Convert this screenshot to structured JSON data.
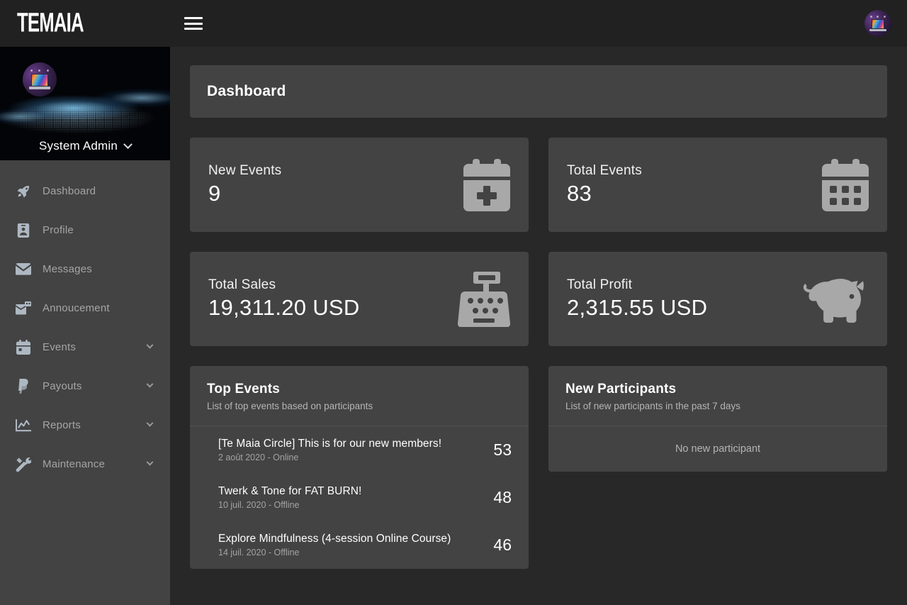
{
  "brand": {
    "name": "TE MAIA",
    "logo_text": "TEMAIA"
  },
  "topbar": {
    "menu_icon": "hamburger-menu-icon",
    "avatar_alt": "user-avatar"
  },
  "sidebar": {
    "profile": {
      "name": "System Admin",
      "caret_icon": "chevron-down-icon",
      "avatar_alt": "profile-avatar"
    },
    "items": [
      {
        "label": "Dashboard",
        "icon": "rocket-icon",
        "expandable": false
      },
      {
        "label": "Profile",
        "icon": "id-card-icon",
        "expandable": false
      },
      {
        "label": "Messages",
        "icon": "envelope-icon",
        "expandable": false
      },
      {
        "label": "Annoucement",
        "icon": "announcement-icon",
        "expandable": false
      },
      {
        "label": "Events",
        "icon": "calendar-icon",
        "expandable": true
      },
      {
        "label": "Payouts",
        "icon": "paypal-icon",
        "expandable": true
      },
      {
        "label": "Reports",
        "icon": "chart-line-icon",
        "expandable": true
      },
      {
        "label": "Maintenance",
        "icon": "tools-icon",
        "expandable": true
      }
    ]
  },
  "main": {
    "page_title": "Dashboard",
    "stats": [
      {
        "label": "New Events",
        "value": "9",
        "icon": "calendar-plus-icon"
      },
      {
        "label": "Total Events",
        "value": "83",
        "icon": "calendar-days-icon"
      },
      {
        "label": "Total Sales",
        "value": "19,311.20 USD",
        "icon": "cash-register-icon"
      },
      {
        "label": "Total Profit",
        "value": "2,315.55 USD",
        "icon": "piggy-bank-icon"
      }
    ],
    "top_events": {
      "title": "Top Events",
      "subtitle": "List of top events based on participants",
      "rows": [
        {
          "name": "[Te Maia Circle] This is for our new members!",
          "meta": "2 août 2020 - Online",
          "count": "53"
        },
        {
          "name": "Twerk & Tone for FAT BURN!",
          "meta": "10 juil. 2020 - Offline",
          "count": "48"
        },
        {
          "name": "Explore Mindfulness (4-session Online Course)",
          "meta": "14 juil. 2020 - Offline",
          "count": "46"
        }
      ]
    },
    "new_participants": {
      "title": "New Participants",
      "subtitle": "List of new participants in the past 7 days",
      "empty_text": "No new participant"
    }
  },
  "colors": {
    "app_bg": "#282828",
    "card_bg": "#434343",
    "topbar_bg": "#212121",
    "text_primary": "#ffffff",
    "text_muted": "#a5a5a5",
    "icon_grey": "#a8a8a8",
    "banner_accent": "#78c3eb"
  }
}
